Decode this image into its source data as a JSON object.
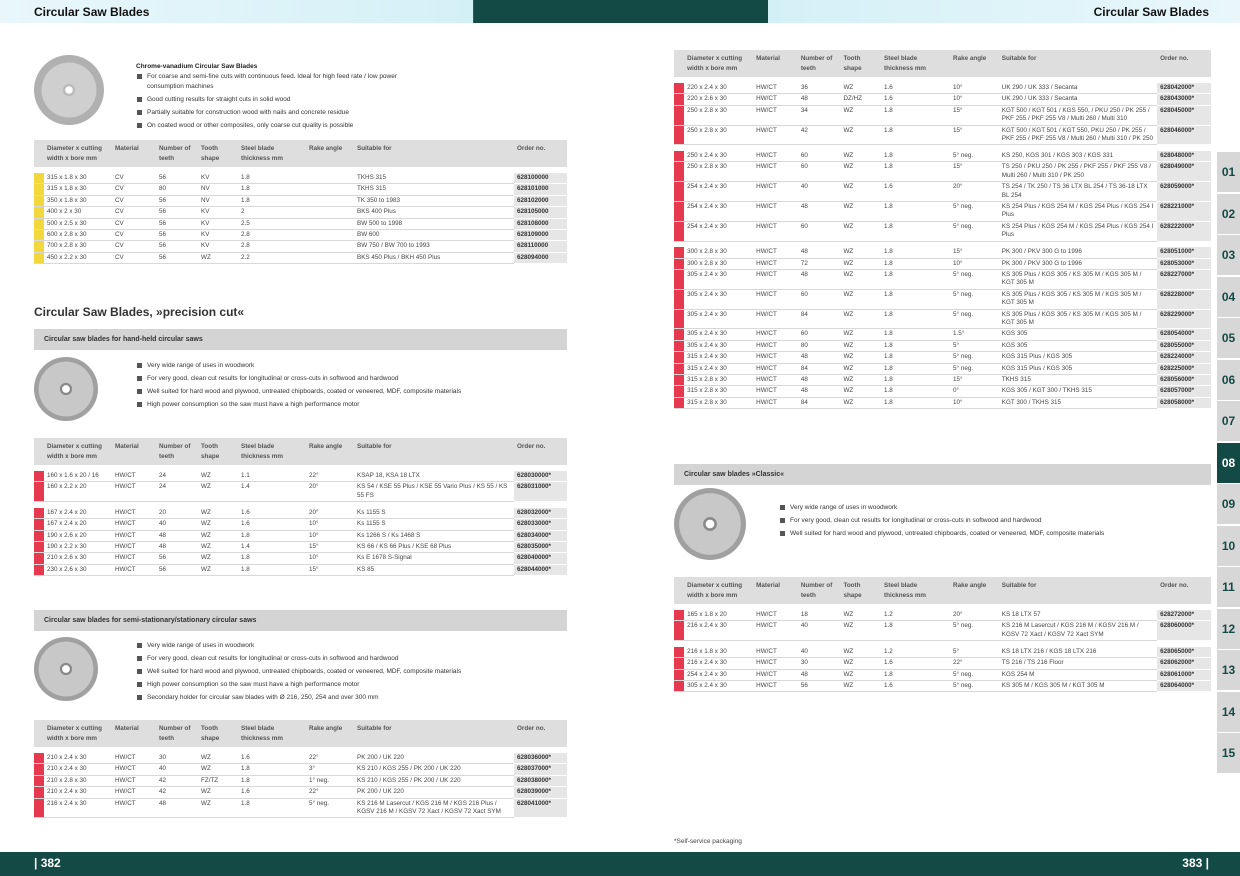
{
  "header": {
    "left_title": "Circular Saw Blades",
    "right_title": "Circular Saw Blades"
  },
  "footer": {
    "left_page": "| 382",
    "right_page": "383 |"
  },
  "tabs": [
    "01",
    "02",
    "03",
    "04",
    "05",
    "06",
    "07",
    "08",
    "09",
    "10",
    "11",
    "12",
    "13",
    "14",
    "15"
  ],
  "active_tab": "08",
  "columns": [
    "Diameter x cutting width x bore mm",
    "Material",
    "Number of teeth",
    "Tooth shape",
    "Steel blade thickness mm",
    "Rake angle",
    "Suitable for",
    "Order no."
  ],
  "block1": {
    "title": "Chrome-vanadium Circular Saw Blades",
    "bullets": [
      "For coarse and semi-fine cuts with continuous feed. Ideal for high feed rate / low power consumption machines",
      "Good cutting results for straight cuts in solid wood",
      "Partially suitable for construction wood with nails and concrete residue",
      "On coated wood or other composites, only coarse cut quality is possible"
    ],
    "rows": [
      [
        "315 x 1.8 x 30",
        "CV",
        "56",
        "KV",
        "1.8",
        "",
        "TKHS 315",
        "628100000"
      ],
      [
        "315 x 1.8 x 30",
        "CV",
        "80",
        "NV",
        "1.8",
        "",
        "TKHS 315",
        "628101000"
      ],
      [
        "350 x 1.8 x 30",
        "CV",
        "56",
        "NV",
        "1.8",
        "",
        "TK 350 to 1983",
        "628102000"
      ],
      [
        "400 x 2 x 30",
        "CV",
        "56",
        "KV",
        "2",
        "",
        "BKS 400 Plus",
        "628105000"
      ],
      [
        "500 x 2.5 x 30",
        "CV",
        "56",
        "KV",
        "2.5",
        "",
        "BW 500 to 1998",
        "628108000"
      ],
      [
        "600 x 2.8 x 30",
        "CV",
        "56",
        "KV",
        "2.8",
        "",
        "BW 600",
        "628109000"
      ],
      [
        "700 x 2.8 x 30",
        "CV",
        "56",
        "KV",
        "2.8",
        "",
        "BW 750 / BW 700 to 1993",
        "628110000"
      ],
      [
        "450 x 2.2 x 30",
        "CV",
        "56",
        "WZ",
        "2.2",
        "",
        "BKS 450 Plus / BKH 450 Plus",
        "628094000"
      ]
    ]
  },
  "precision": {
    "title": "Circular Saw Blades, »precision cut«",
    "handheld": {
      "bar": "Circular saw blades for hand-held circular saws",
      "bullets": [
        "Very wide range of uses in woodwork",
        "For very good, clean cut results for longitudinal or cross-cuts in softwood and hardwood",
        "Well suited for hard wood and plywood, untreated chipboards, coated or veneered, MDF, composite materials",
        "High power consumption so the saw must have a high performance motor"
      ],
      "groups": [
        [
          [
            "160 x 1.6 x 20 / 16",
            "HW/CT",
            "24",
            "WZ",
            "1.1",
            "22°",
            "KSAP 18, KSA 18 LTX",
            "628030000*"
          ],
          [
            "160 x 2.2 x 20",
            "HW/CT",
            "24",
            "WZ",
            "1.4",
            "20°",
            "KS 54 / KSE 55 Plus / KSE 55 Vario Plus / KS 55 / KS 55 FS",
            "628031000*"
          ]
        ],
        [
          [
            "167 x 2.4 x 20",
            "HW/CT",
            "20",
            "WZ",
            "1.6",
            "20°",
            "Ks 1155 S",
            "628032000*"
          ],
          [
            "167 x 2.4 x 20",
            "HW/CT",
            "40",
            "WZ",
            "1.6",
            "10°",
            "Ks 1155 S",
            "628033000*"
          ],
          [
            "190 x 2.6 x 20",
            "HW/CT",
            "48",
            "WZ",
            "1.8",
            "10°",
            "Ks 1266 S / Ks 1468 S",
            "628034000*"
          ],
          [
            "190 x 2.2 x 30",
            "HW/CT",
            "48",
            "WZ",
            "1.4",
            "15°",
            "KS 66 / KS 66 Plus / KSE 68 Plus",
            "628035000*"
          ],
          [
            "210 x 2.6 x 30",
            "HW/CT",
            "56",
            "WZ",
            "1.8",
            "10°",
            "Ks E 1678 S-Signal",
            "628040000*"
          ],
          [
            "230 x 2.6 x 30",
            "HW/CT",
            "56",
            "WZ",
            "1.8",
            "15°",
            "KS 85",
            "628044000*"
          ]
        ]
      ]
    },
    "stationary": {
      "bar": "Circular saw blades for semi-stationary/stationary circular saws",
      "bullets": [
        "Very wide range of uses in woodwork",
        "For very good, clean cut results for longitudinal or cross-cuts in softwood and hardwood",
        "Well suited for hard wood and plywood, untreated chipboards, coated or veneered, MDF, composite materials",
        "High power consumption so the saw must have a high performance motor",
        "Secondary holder for circular saw blades with Ø 216, 250, 254 and over 300 mm"
      ],
      "rows": [
        [
          "210 x 2.4 x 30",
          "HW/CT",
          "30",
          "WZ",
          "1.6",
          "22°",
          "PK 200 / UK 220",
          "628036000*"
        ],
        [
          "210 x 2.4 x 30",
          "HW/CT",
          "40",
          "WZ",
          "1.8",
          "3°",
          "KS 210 / KGS 255 / PK 200 / UK 220",
          "628037000*"
        ],
        [
          "210 x 2.8 x 30",
          "HW/CT",
          "42",
          "FZ/TZ",
          "1.8",
          "1° neg.",
          "KS 210 / KGS 255 / PK 200 / UK 220",
          "628038000*"
        ],
        [
          "210 x 2.4 x 30",
          "HW/CT",
          "42",
          "WZ",
          "1.6",
          "22°",
          "PK 200 / UK 220",
          "628039000*"
        ],
        [
          "216 x 2.4 x 30",
          "HW/CT",
          "48",
          "WZ",
          "1.8",
          "5° neg.",
          "KS 216 M Lasercut / KGS 216 M / KGS 216 Plus / KGSV 216 M / KGSV 72 Xact / KGSV 72 Xact SYM",
          "628041000*"
        ]
      ]
    }
  },
  "right_table": {
    "groups": [
      [
        [
          "220 x 2.4 x 30",
          "HW/CT",
          "36",
          "WZ",
          "1.6",
          "10°",
          "UK 290 / UK 333 / Secanta",
          "628042000*"
        ],
        [
          "220 x 2.6 x 30",
          "HW/CT",
          "48",
          "DZ/HZ",
          "1.6",
          "10°",
          "UK 290 / UK 333 / Secanta",
          "628043000*"
        ],
        [
          "250 x 2.8 x 30",
          "HW/CT",
          "34",
          "WZ",
          "1.8",
          "15°",
          "KGT 500 / KGT 501 / KGS 550, / PKU 250 / PK 255 / PKF 255 / PKF 255 V8 / Multi 260 / Multi 310",
          "628045000*"
        ],
        [
          "250 x 2.8 x 30",
          "HW/CT",
          "42",
          "WZ",
          "1.8",
          "15°",
          "KGT 500 / KGT 501 / KGT 550, PKU 250 / PK 255 / PKF 255 / PKF 255 V8 / Multi 260 / Multi 310 / PK 250",
          "628046000*"
        ]
      ],
      [
        [
          "250 x 2.4 x 30",
          "HW/CT",
          "60",
          "WZ",
          "1.8",
          "5° neg.",
          "KS 250, KGS 301 / KGS 303 / KGS 331",
          "628048000*"
        ],
        [
          "250 x 2.8 x 30",
          "HW/CT",
          "60",
          "WZ",
          "1.8",
          "15°",
          "TS 250 / PKU 250 / PK 255 / PKF 255 / PKF 255 V8 / Multi 260 / Multi 310 / PK 250",
          "628049000*"
        ],
        [
          "254 x 2.4 x 30",
          "HW/CT",
          "40",
          "WZ",
          "1.6",
          "20°",
          "TS 254 / TK 250 / TS 36 LTX BL 254 / TS 36-18 LTX BL 254",
          "628059000*"
        ],
        [
          "254 x 2.4 x 30",
          "HW/CT",
          "48",
          "WZ",
          "1.8",
          "5° neg.",
          "KS 254 Plus / KGS 254 M / KGS 254 Plus / KGS 254 I Plus",
          "628221000*"
        ],
        [
          "254 x 2.4 x 30",
          "HW/CT",
          "60",
          "WZ",
          "1.8",
          "5° neg.",
          "KS 254 Plus / KGS 254 M / KGS 254 Plus / KGS 254 I Plus",
          "628222000*"
        ]
      ],
      [
        [
          "300 x 2.8 x 30",
          "HW/CT",
          "48",
          "WZ",
          "1.8",
          "15°",
          "PK 300 / PKV 300 G to 1996",
          "628051000*"
        ],
        [
          "300 x 2.8 x 30",
          "HW/CT",
          "72",
          "WZ",
          "1.8",
          "10°",
          "PK 300 / PKV 300 G to 1996",
          "628053000*"
        ],
        [
          "305 x 2.4 x 30",
          "HW/CT",
          "48",
          "WZ",
          "1.8",
          "5° neg.",
          "KS 305 Plus / KGS 305 / KS 305 M / KGS 305 M / KGT 305 M",
          "628227000*"
        ],
        [
          "305 x 2.4 x 30",
          "HW/CT",
          "60",
          "WZ",
          "1.8",
          "5° neg.",
          "KS 305 Plus / KGS 305 / KS 305 M / KGS 305 M / KGT 305 M",
          "628228000*"
        ],
        [
          "305 x 2.4 x 30",
          "HW/CT",
          "84",
          "WZ",
          "1.8",
          "5° neg.",
          "KS 305 Plus / KGS 305 / KS 305 M / KGS 305 M / KGT 305 M",
          "628229000*"
        ],
        [
          "305 x 2.4 x 30",
          "HW/CT",
          "60",
          "WZ",
          "1.8",
          "1.5°",
          "KGS 305",
          "628054000*"
        ],
        [
          "305 x 2.4 x 30",
          "HW/CT",
          "80",
          "WZ",
          "1.8",
          "5°",
          "KGS 305",
          "628055000*"
        ],
        [
          "315 x 2.4 x 30",
          "HW/CT",
          "48",
          "WZ",
          "1.8",
          "5° neg.",
          "KGS 315 Plus / KGS 305",
          "628224000*"
        ],
        [
          "315 x 2.4 x 30",
          "HW/CT",
          "84",
          "WZ",
          "1.8",
          "5° neg.",
          "KGS 315 Plus / KGS 305",
          "628225000*"
        ],
        [
          "315 x 2.8 x 30",
          "HW/CT",
          "48",
          "WZ",
          "1.8",
          "15°",
          "TKHS 315",
          "628056000*"
        ],
        [
          "315 x 2.8 x 30",
          "HW/CT",
          "48",
          "WZ",
          "1.8",
          "0°",
          "KGS 305 / KGT 300 / TKHS 315",
          "628057000*"
        ],
        [
          "315 x 2.8 x 30",
          "HW/CT",
          "84",
          "WZ",
          "1.8",
          "10°",
          "KGT 300 / TKHS 315",
          "628058000*"
        ]
      ]
    ]
  },
  "classic": {
    "bar": "Circular saw blades »Classic«",
    "bullets": [
      "Very wide range of uses in woodwork",
      "For very good, clean cut results for longitudinal or cross-cuts in softwood and hardwood",
      "Well suited for hard wood and plywood, untreated chipboards, coated or veneered, MDF, composite materials"
    ],
    "groups": [
      [
        [
          "165 x 1.8 x 20",
          "HW/CT",
          "18",
          "WZ",
          "1.2",
          "20°",
          "KS 18 LTX 57",
          "628272000*"
        ],
        [
          "216 x 2.4 x 30",
          "HW/CT",
          "40",
          "WZ",
          "1.8",
          "5° neg.",
          "KS 216 M Lasercut / KGS 216 M / KGSV 216 M / KGSV 72 Xact / KGSV 72 Xact SYM",
          "628060000*"
        ]
      ],
      [
        [
          "216 x 1.8 x 30",
          "HW/CT",
          "40",
          "WZ",
          "1.2",
          "5°",
          "KS 18 LTX 216 / KGS 18 LTX 216",
          "628065000*"
        ],
        [
          "216 x 2.4 x 30",
          "HW/CT",
          "30",
          "WZ",
          "1.6",
          "22°",
          "TS 216 / TS 216 Floor",
          "628062000*"
        ],
        [
          "254 x 2.4 x 30",
          "HW/CT",
          "48",
          "WZ",
          "1.8",
          "5° neg.",
          "KGS 254 M",
          "628061000*"
        ],
        [
          "305 x 2.4 x 30",
          "HW/CT",
          "56",
          "WZ",
          "1.6",
          "5° neg.",
          "KS 305 M / KGS 305 M / KGT 305 M",
          "628064000*"
        ]
      ]
    ]
  },
  "footnote": "*Self-service packaging",
  "colors": {
    "header_dark": "#144a45",
    "header_light": "#d4f0f7",
    "marker_yellow": "#f2d83c",
    "marker_red": "#e63950"
  }
}
